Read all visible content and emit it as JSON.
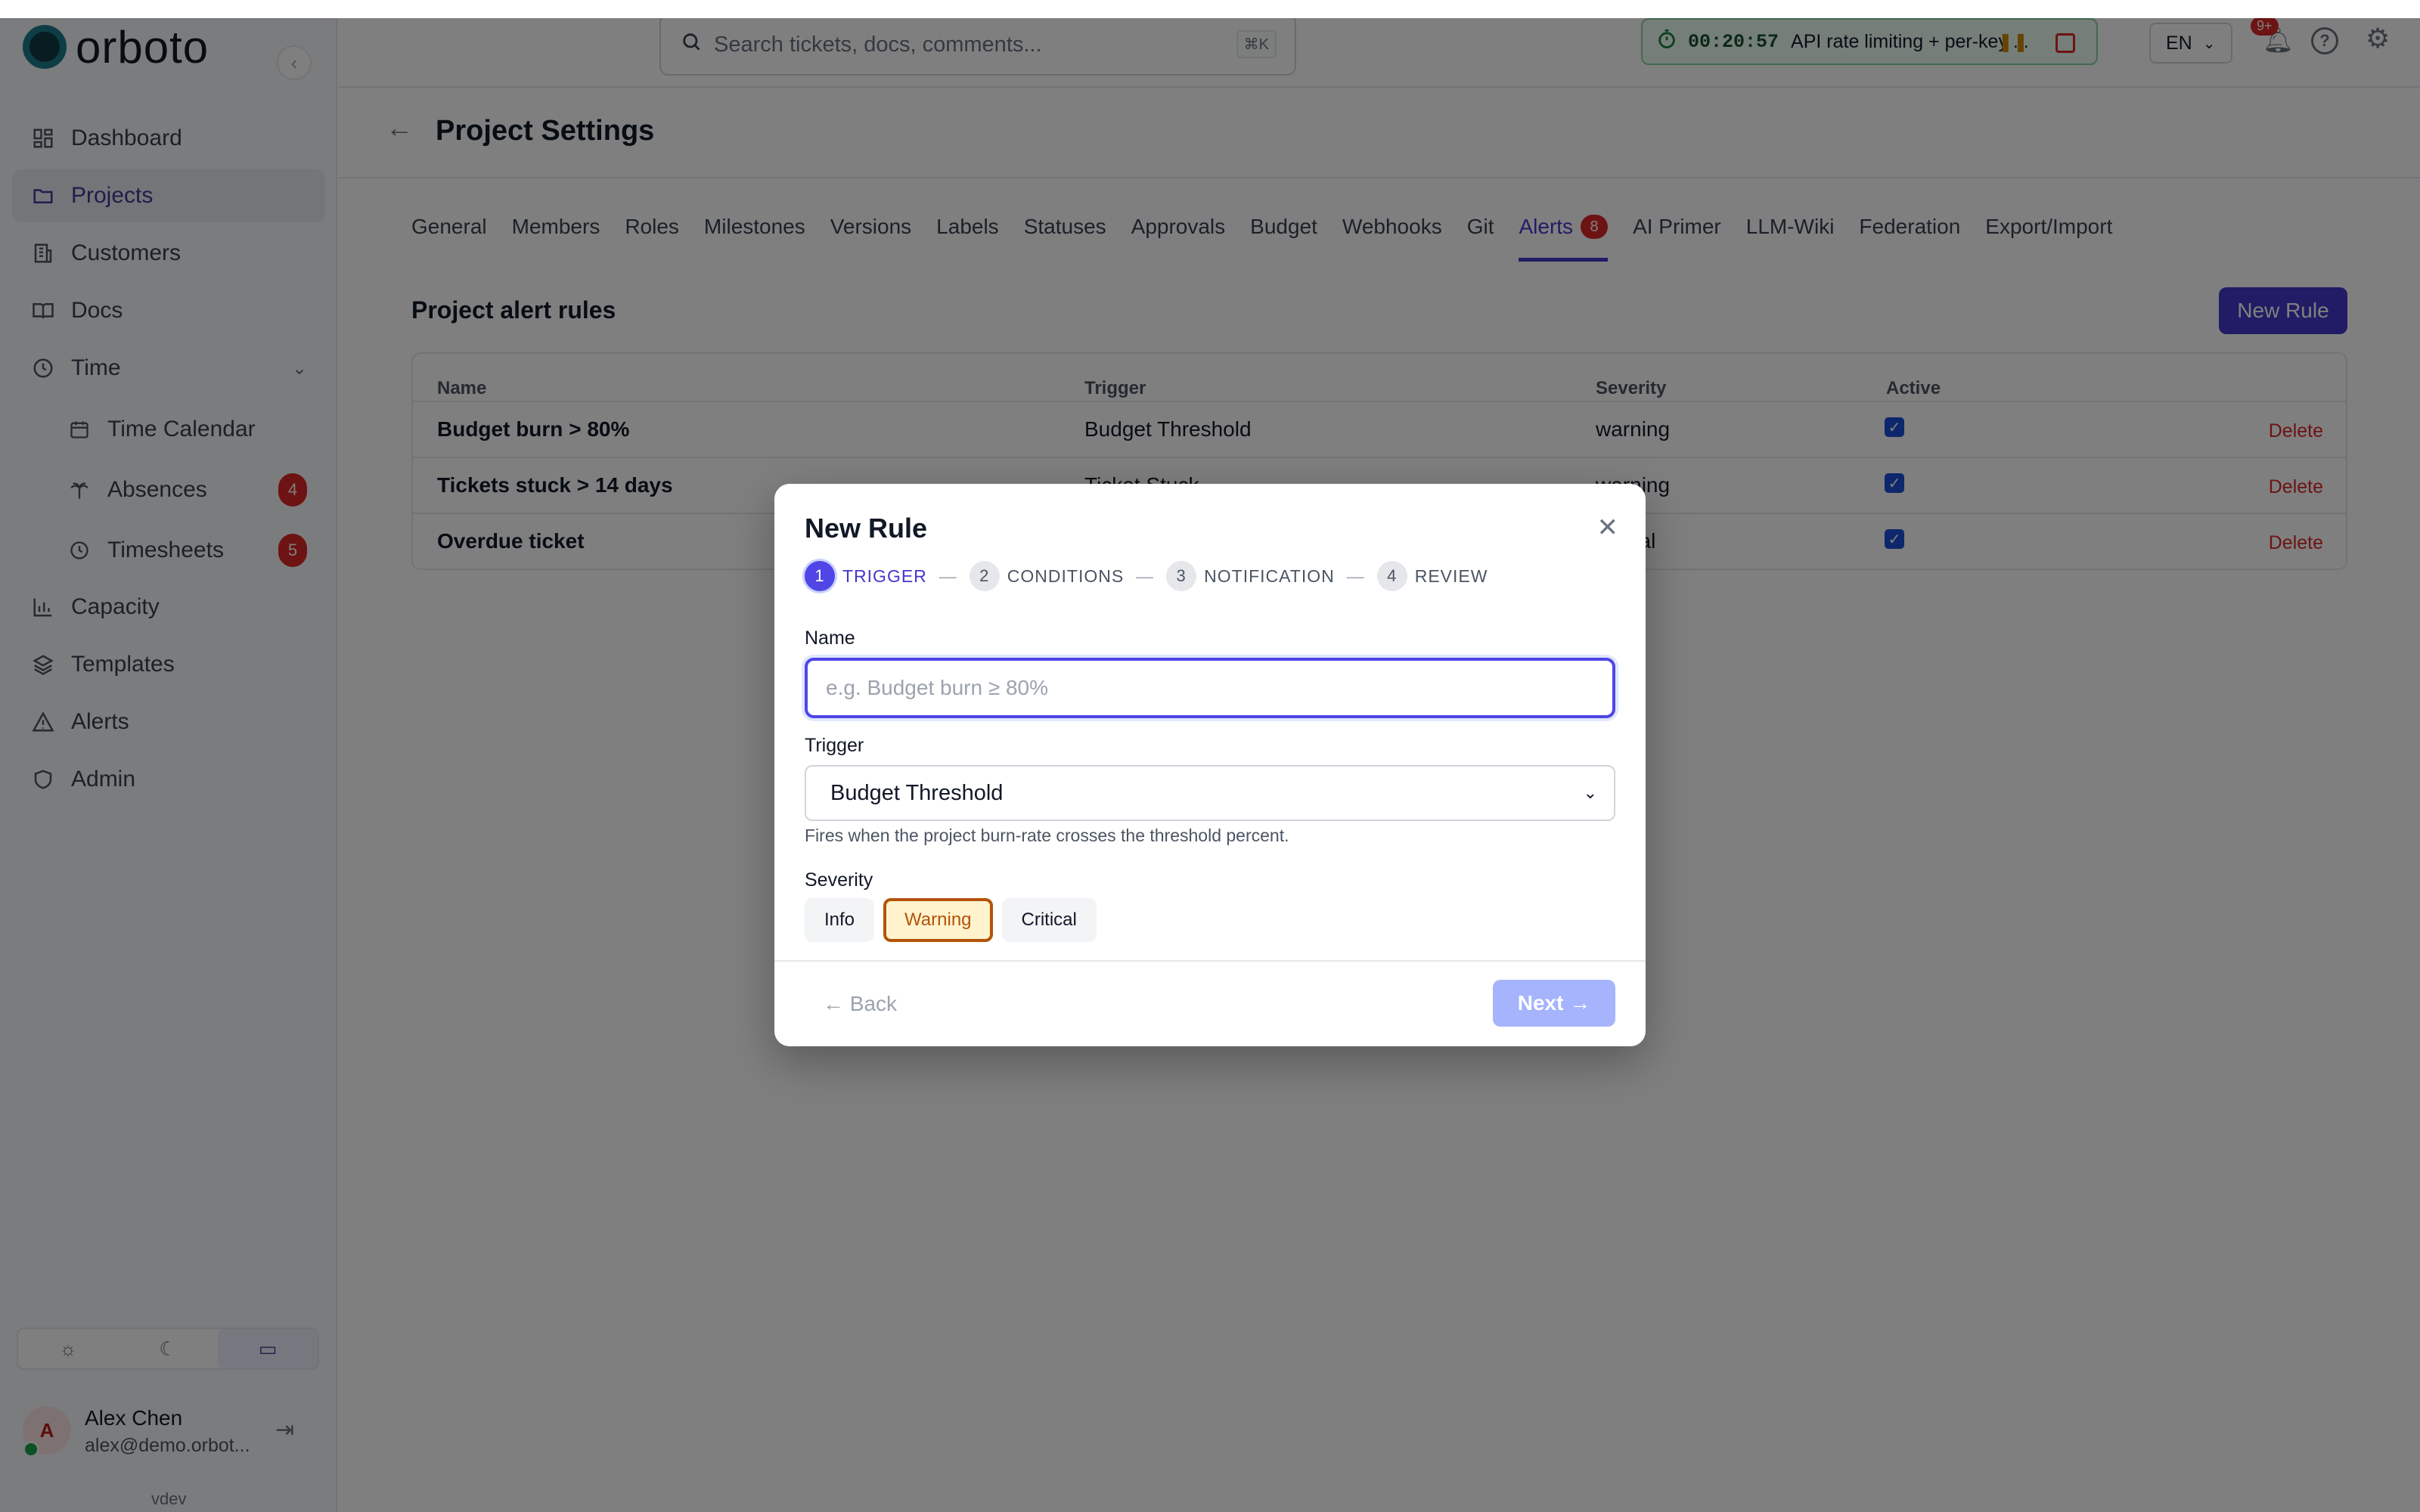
{
  "app": {
    "logo_text": "orboto",
    "version": "vdev"
  },
  "sidebar": {
    "items": [
      {
        "label": "Dashboard"
      },
      {
        "label": "Projects"
      },
      {
        "label": "Customers"
      },
      {
        "label": "Docs"
      },
      {
        "label": "Time"
      },
      {
        "label": "Time Calendar"
      },
      {
        "label": "Absences",
        "badge": "4"
      },
      {
        "label": "Timesheets",
        "badge": "5"
      },
      {
        "label": "Capacity"
      },
      {
        "label": "Templates"
      },
      {
        "label": "Alerts"
      },
      {
        "label": "Admin"
      }
    ],
    "active": "Projects",
    "theme_mode": "system",
    "user": {
      "avatar_initial": "A",
      "name": "Alex Chen",
      "email": "alex@demo.orbot..."
    }
  },
  "header": {
    "search_placeholder": "Search tickets, docs, comments...",
    "search_shortcut": "⌘K",
    "timer": {
      "time": "00:20:57",
      "description": "API rate limiting + per-key ..."
    },
    "language": "EN",
    "notifications_badge": "9+"
  },
  "page": {
    "title": "Project Settings",
    "tabs": [
      {
        "label": "General"
      },
      {
        "label": "Members"
      },
      {
        "label": "Roles"
      },
      {
        "label": "Milestones"
      },
      {
        "label": "Versions"
      },
      {
        "label": "Labels"
      },
      {
        "label": "Statuses"
      },
      {
        "label": "Approvals"
      },
      {
        "label": "Budget"
      },
      {
        "label": "Webhooks"
      },
      {
        "label": "Git"
      },
      {
        "label": "Alerts",
        "badge": "8"
      },
      {
        "label": "AI Primer"
      },
      {
        "label": "LLM-Wiki"
      },
      {
        "label": "Federation"
      },
      {
        "label": "Export/Import"
      }
    ],
    "active_tab": "Alerts",
    "section_title": "Project alert rules",
    "new_rule_label": "New Rule",
    "table": {
      "headers": [
        "Name",
        "Trigger",
        "Severity",
        "Active"
      ],
      "rows": [
        {
          "name": "Budget burn > 80%",
          "trigger": "Budget Threshold",
          "severity": "warning",
          "active": true,
          "action": "Delete"
        },
        {
          "name": "Tickets stuck > 14 days",
          "trigger": "Ticket Stuck",
          "severity": "warning",
          "active": true,
          "action": "Delete"
        },
        {
          "name": "Overdue ticket",
          "trigger": "",
          "severity": "critical",
          "active": true,
          "action": "Delete"
        }
      ]
    }
  },
  "modal": {
    "title": "New Rule",
    "steps": [
      {
        "num": "1",
        "label": "TRIGGER"
      },
      {
        "num": "2",
        "label": "CONDITIONS"
      },
      {
        "num": "3",
        "label": "NOTIFICATION"
      },
      {
        "num": "4",
        "label": "REVIEW"
      }
    ],
    "current_step": 1,
    "name_label": "Name",
    "name_placeholder": "e.g. Budget burn ≥ 80%",
    "name_value": "",
    "trigger_label": "Trigger",
    "trigger_value": "Budget Threshold",
    "trigger_hint": "Fires when the project burn-rate crosses the threshold percent.",
    "severity_label": "Severity",
    "severity_options": [
      "Info",
      "Warning",
      "Critical"
    ],
    "severity_selected": "Warning",
    "back_label": "Back",
    "next_label": "Next",
    "colors": {
      "primary": "#4f46e5",
      "warning": "#b45309",
      "danger": "#dc2626"
    }
  }
}
